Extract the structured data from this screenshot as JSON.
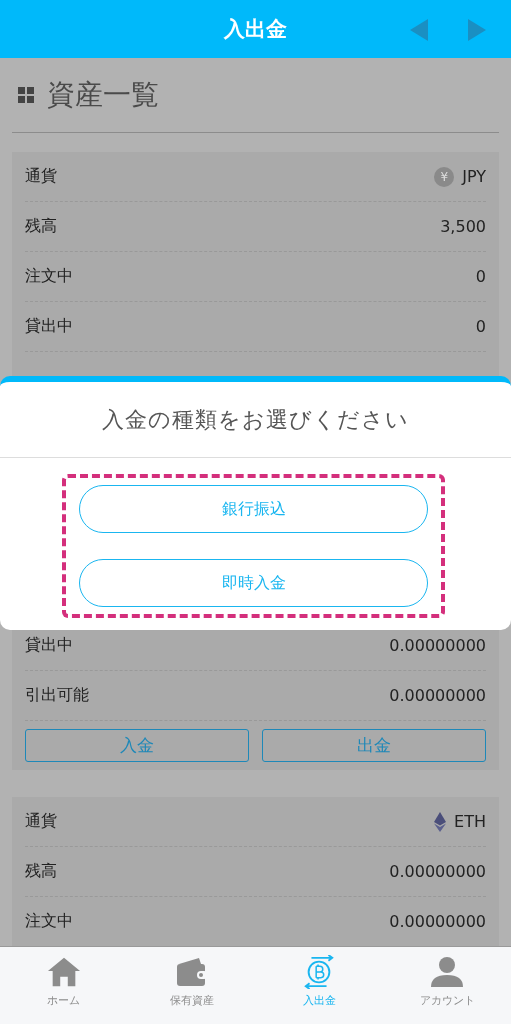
{
  "header": {
    "title": "入出金"
  },
  "section": {
    "title": "資産一覧"
  },
  "cards": [
    {
      "rows": [
        {
          "kind": "currency",
          "label": "通貨",
          "value": "JPY",
          "badge": "¥"
        },
        {
          "kind": "plain",
          "label": "残高",
          "value": "3,500"
        },
        {
          "kind": "plain",
          "label": "注文中",
          "value": "0"
        },
        {
          "kind": "plain",
          "label": "貸出中",
          "value": "0"
        }
      ]
    },
    {
      "rows": [
        {
          "kind": "plain",
          "label": "貸出中",
          "value": "0.00000000"
        },
        {
          "kind": "plain",
          "label": "引出可能",
          "value": "0.00000000"
        }
      ],
      "buttons": [
        "入金",
        "出金"
      ]
    },
    {
      "rows": [
        {
          "kind": "currency",
          "label": "通貨",
          "value": "ETH"
        },
        {
          "kind": "plain",
          "label": "残高",
          "value": "0.00000000"
        },
        {
          "kind": "plain",
          "label": "注文中",
          "value": "0.00000000"
        }
      ]
    }
  ],
  "dialog": {
    "title": "入金の種類をお選びください",
    "highlighted": true,
    "options": [
      "銀行振込",
      "即時入金"
    ]
  },
  "nav": [
    {
      "label": "ホーム",
      "selected": false
    },
    {
      "label": "保有資産",
      "selected": false
    },
    {
      "label": "入出金",
      "selected": true
    },
    {
      "label": "アカウント",
      "selected": false
    }
  ]
}
